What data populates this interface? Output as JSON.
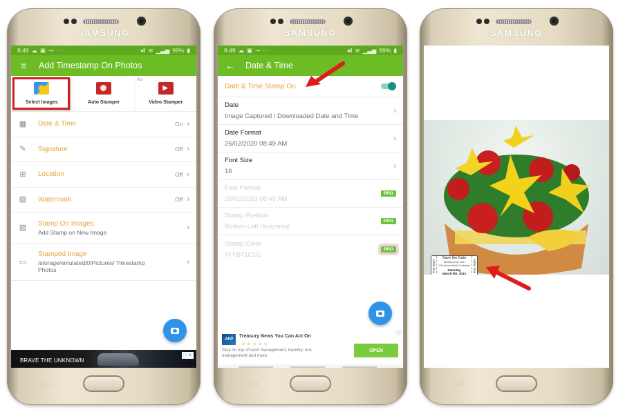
{
  "device_brand": "SAMSUNG",
  "status_bar": {
    "time": "8:49",
    "left_icons": [
      "cloud-icon",
      "gallery-icon",
      "key-icon",
      "more-icon"
    ],
    "battery": "99%"
  },
  "screen1": {
    "app_title": "Add Timestamp On Photos",
    "features": [
      {
        "label": "Select Images",
        "icon": "select-images-icon",
        "selected": true
      },
      {
        "label": "Auto Stamper",
        "icon": "auto-stamper-icon",
        "selected": false
      },
      {
        "label": "Video Stamper",
        "icon": "video-stamper-icon",
        "selected": false
      }
    ],
    "ad_label": "Ad",
    "menu": [
      {
        "label": "Date & Time",
        "value": "On",
        "icon": "calendar-icon"
      },
      {
        "label": "Signature",
        "value": "Off",
        "icon": "signature-pen-icon"
      },
      {
        "label": "Location",
        "value": "Off",
        "icon": "map-icon"
      },
      {
        "label": "Watermark",
        "value": "Off",
        "icon": "watermark-image-icon"
      },
      {
        "label": "Stamp On Images",
        "sub": "Add Stamp on New Image",
        "icon": "image-stamp-icon"
      },
      {
        "label": "Stamped Image",
        "sub": "/storage/emulated/0/Pictures/ Timestamp Photos",
        "icon": "folder-icon"
      }
    ],
    "banner_ad_text": "BRAVE THE UNKNOWN"
  },
  "screen2": {
    "title": "Date & Time",
    "toggle_label": "Date & Time Stamp On",
    "toggle_on": true,
    "settings": [
      {
        "label": "Date",
        "value": "Image Captured / Downloaded Date and Time",
        "pro": false,
        "disabled": false
      },
      {
        "label": "Date Format",
        "value": "26/02/2020 08:49 AM",
        "pro": false,
        "disabled": false
      },
      {
        "label": "Font Size",
        "value": "16",
        "pro": false,
        "disabled": false
      },
      {
        "label": "Font Format",
        "value": "26/02/2020 08:49 AM",
        "pro": true,
        "disabled": true
      },
      {
        "label": "Stamp Position",
        "value": "Bottom Left Horizontal",
        "pro": true,
        "disabled": true
      },
      {
        "label": "Stamp Color",
        "value": "#FFB71C1C",
        "pro": true,
        "disabled": true
      }
    ],
    "pro_label": "PRO",
    "native_ad": {
      "logo": "AFP",
      "title": "Treasury News You Can Act On",
      "stars": "★★★★★",
      "description": "Stay on top of cash management, liquidity, risk management and more.",
      "button": "OPEN"
    }
  },
  "screen3": {
    "stamp": {
      "side_left": "Admit One",
      "side_right": "Admit One",
      "title": "Save the Date",
      "line2": "Winnipeg Run Club",
      "line3": "17th Annual Youth Fundraiser",
      "day": "Saturday",
      "date": "March 9th, 2013"
    }
  },
  "colors": {
    "status_bar": "#5fa91f",
    "app_bar": "#6cbd25",
    "accent_label": "#e8a33c",
    "fab": "#2f93e8",
    "highlight_red": "#d21f1f",
    "toggle_on": "#16917f",
    "pro_badge": "#6cc23a"
  }
}
